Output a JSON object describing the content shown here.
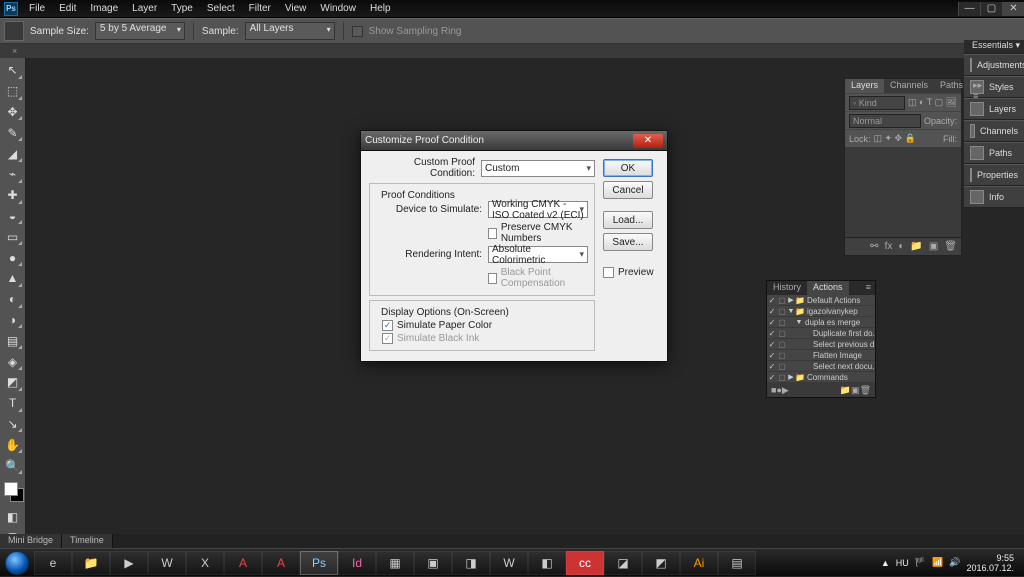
{
  "menu": [
    "File",
    "Edit",
    "Image",
    "Layer",
    "Type",
    "Select",
    "Filter",
    "View",
    "Window",
    "Help"
  ],
  "options": {
    "sample_size_label": "Sample Size:",
    "sample_size_value": "5 by 5 Average",
    "sample_label": "Sample:",
    "sample_value": "All Layers",
    "show_ring": "Show Sampling Ring"
  },
  "tools": [
    "↖",
    "⬚",
    "✥",
    "✎",
    "◢",
    "⌁",
    "✚",
    "◒",
    "▭",
    "●",
    "▲",
    "◐",
    "◑",
    "▤",
    "◈",
    "◩",
    "T",
    "↘",
    "✋",
    "🔍"
  ],
  "right_header": "Essentials",
  "right_tabs": [
    "Adjustments",
    "Styles",
    "Layers",
    "Channels",
    "Paths",
    "Properties",
    "Info"
  ],
  "layers": {
    "tabs": [
      "Layers",
      "Channels",
      "Paths"
    ],
    "kind": "◦ Kind",
    "blend": "Normal",
    "opacity_label": "Opacity:",
    "lock_label": "Lock:",
    "fill_label": "Fill:"
  },
  "actions": {
    "tabs": [
      "History",
      "Actions"
    ],
    "items": [
      {
        "chk": "✓",
        "arrow": "▶",
        "icon": "📁",
        "name": "Default Actions",
        "indent": 0
      },
      {
        "chk": "✓",
        "arrow": "▼",
        "icon": "📁",
        "name": "igazolvanykep",
        "indent": 0
      },
      {
        "chk": "✓",
        "arrow": "▼",
        "icon": "",
        "name": "dupla es merge",
        "indent": 1
      },
      {
        "chk": "✓",
        "arrow": "",
        "icon": "",
        "name": "Duplicate first do...",
        "indent": 2
      },
      {
        "chk": "✓",
        "arrow": "",
        "icon": "",
        "name": "Select previous d...",
        "indent": 2
      },
      {
        "chk": "✓",
        "arrow": "",
        "icon": "",
        "name": "Flatten Image",
        "indent": 2
      },
      {
        "chk": "✓",
        "arrow": "",
        "icon": "",
        "name": "Select next docu...",
        "indent": 2
      },
      {
        "chk": "✓",
        "arrow": "▶",
        "icon": "📁",
        "name": "Commands",
        "indent": 0
      }
    ]
  },
  "dialog": {
    "title": "Customize Proof Condition",
    "custom_label": "Custom Proof Condition:",
    "custom_value": "Custom",
    "conditions_legend": "Proof Conditions",
    "device_label": "Device to Simulate:",
    "device_value": "Working CMYK - ISO Coated v2 (ECI)",
    "preserve": "Preserve CMYK Numbers",
    "intent_label": "Rendering Intent:",
    "intent_value": "Absolute Colorimetric",
    "bpc": "Black Point Compensation",
    "display_legend": "Display Options (On-Screen)",
    "sim_paper": "Simulate Paper Color",
    "sim_ink": "Simulate Black Ink",
    "ok": "OK",
    "cancel": "Cancel",
    "load": "Load...",
    "save": "Save...",
    "preview": "Preview"
  },
  "bottom_tabs": [
    "Mini Bridge",
    "Timeline"
  ],
  "tray": {
    "lang": "HU",
    "time": "9:55",
    "date": "2016.07.12."
  }
}
